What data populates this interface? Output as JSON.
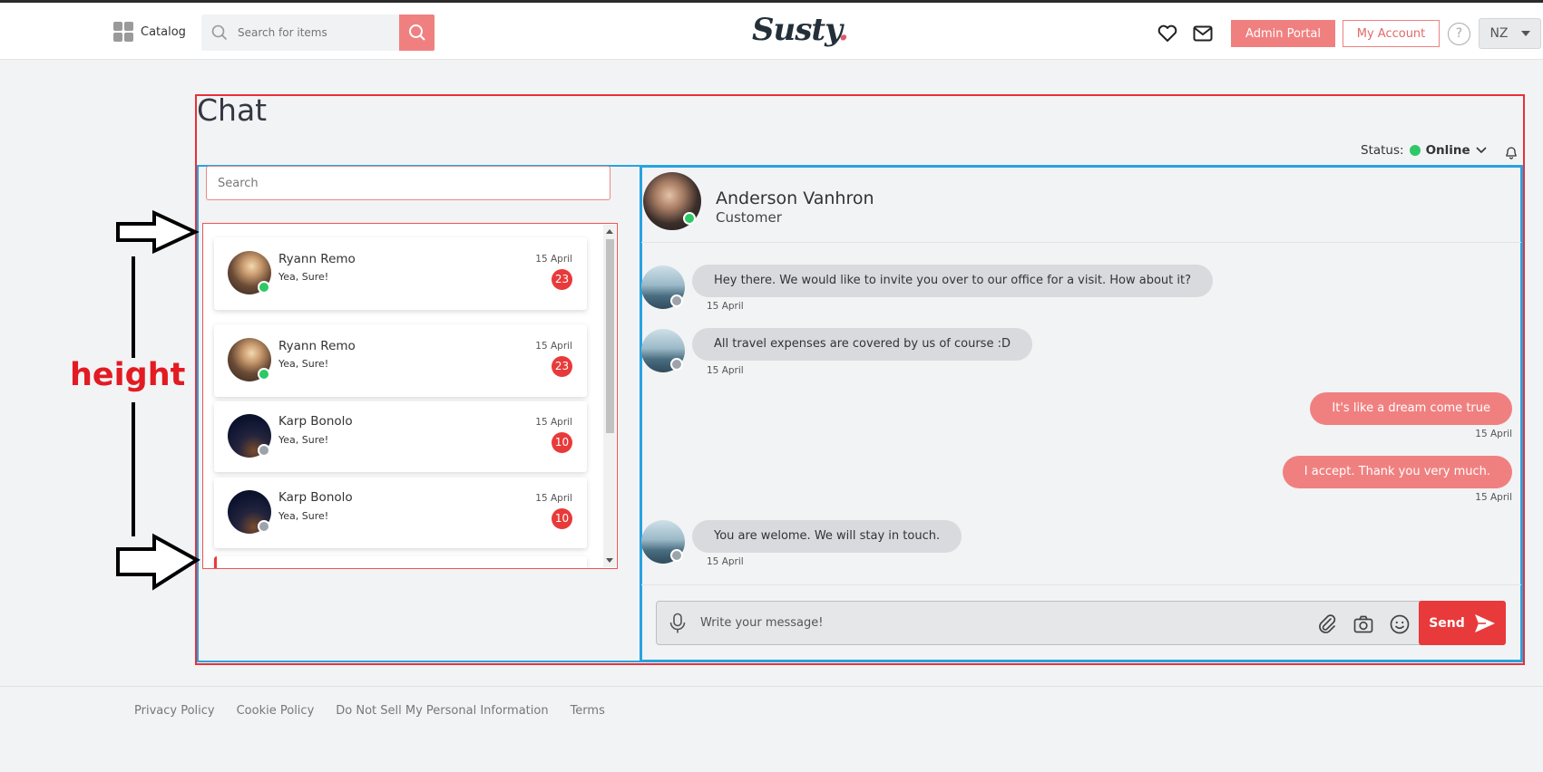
{
  "header": {
    "catalog_label": "Catalog",
    "search_placeholder": "Search for items",
    "logo_text": "Susty",
    "logo_dot": ".",
    "admin_label": "Admin Portal",
    "account_label": "My Account",
    "help_glyph": "?",
    "lang_label": "NZ"
  },
  "page": {
    "title": "Chat",
    "status_label": "Status:",
    "status_value": "Online"
  },
  "chat_list": {
    "search_placeholder": "Search",
    "items": [
      {
        "name": "Ryann Remo",
        "preview": "Yea, Sure!",
        "date": "15 April",
        "unread": "23",
        "online": true,
        "avatar": "sunset"
      },
      {
        "name": "Ryann Remo",
        "preview": "Yea, Sure!",
        "date": "15 April",
        "unread": "23",
        "online": true,
        "avatar": "sunset"
      },
      {
        "name": "Karp Bonolo",
        "preview": "Yea, Sure!",
        "date": "15 April",
        "unread": "10",
        "online": false,
        "avatar": "night"
      },
      {
        "name": "Karp Bonolo",
        "preview": "Yea, Sure!",
        "date": "15 April",
        "unread": "10",
        "online": false,
        "avatar": "night"
      }
    ]
  },
  "conversation": {
    "contact_name": "Anderson Vanhron",
    "contact_role": "Customer",
    "messages": [
      {
        "text": "Hey there. We would like to invite you over to our office for a visit. How about it?",
        "date": "15 April",
        "direction": "in"
      },
      {
        "text": "All travel expenses are covered by us of course :D",
        "date": "15 April",
        "direction": "in"
      },
      {
        "text": "It's like a dream come true",
        "date": "15 April",
        "direction": "out"
      },
      {
        "text": "I accept. Thank you very much.",
        "date": "15 April",
        "direction": "out"
      },
      {
        "text": "You are welome. We will stay in touch.",
        "date": "15 April",
        "direction": "in"
      }
    ],
    "composer_placeholder": "Write your message!",
    "send_label": "Send"
  },
  "footer": {
    "links": [
      "Privacy Policy",
      "Cookie Policy",
      "Do Not Sell My Personal Information",
      "Terms"
    ]
  },
  "annotation": {
    "label": "height"
  },
  "colors": {
    "accent": "#f08080",
    "danger": "#e83a3a",
    "online": "#2ec866",
    "annotation_red": "#e8303a",
    "annotation_blue": "#26a3e0"
  }
}
